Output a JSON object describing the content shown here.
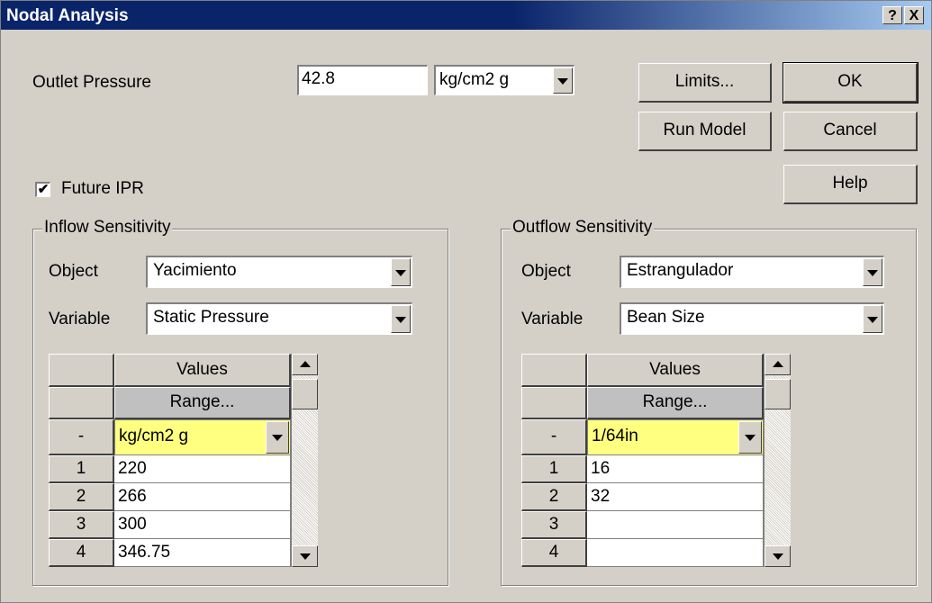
{
  "window": {
    "title": "Nodal Analysis",
    "help_button": "?",
    "close_button": "X"
  },
  "outlet": {
    "label": "Outlet Pressure",
    "value": "42.8",
    "unit": "kg/cm2 g"
  },
  "buttons": {
    "limits": "Limits...",
    "ok": "OK",
    "run_model": "Run Model",
    "cancel": "Cancel",
    "help": "Help"
  },
  "future_ipr": {
    "label": "Future IPR",
    "checked": true,
    "mark": "✔"
  },
  "inflow": {
    "title": "Inflow Sensitivity",
    "object_label": "Object",
    "object_value": "Yacimiento",
    "variable_label": "Variable",
    "variable_value": "Static Pressure",
    "grid": {
      "header": "Values",
      "range": "Range...",
      "unit_row_label": "-",
      "unit": "kg/cm2 g",
      "rows": [
        {
          "num": "1",
          "value": "220"
        },
        {
          "num": "2",
          "value": "266"
        },
        {
          "num": "3",
          "value": "300"
        },
        {
          "num": "4",
          "value": "346.75"
        }
      ]
    }
  },
  "outflow": {
    "title": "Outflow Sensitivity",
    "object_label": "Object",
    "object_value": "Estrangulador",
    "variable_label": "Variable",
    "variable_value": "Bean Size",
    "grid": {
      "header": "Values",
      "range": "Range...",
      "unit_row_label": "-",
      "unit": "1/64in",
      "rows": [
        {
          "num": "1",
          "value": "16"
        },
        {
          "num": "2",
          "value": "32"
        },
        {
          "num": "3",
          "value": ""
        },
        {
          "num": "4",
          "value": ""
        }
      ]
    }
  },
  "colors": {
    "titlebar": "#0a246a",
    "face": "#d4d0c8",
    "unit_cell": "#ffff80"
  }
}
